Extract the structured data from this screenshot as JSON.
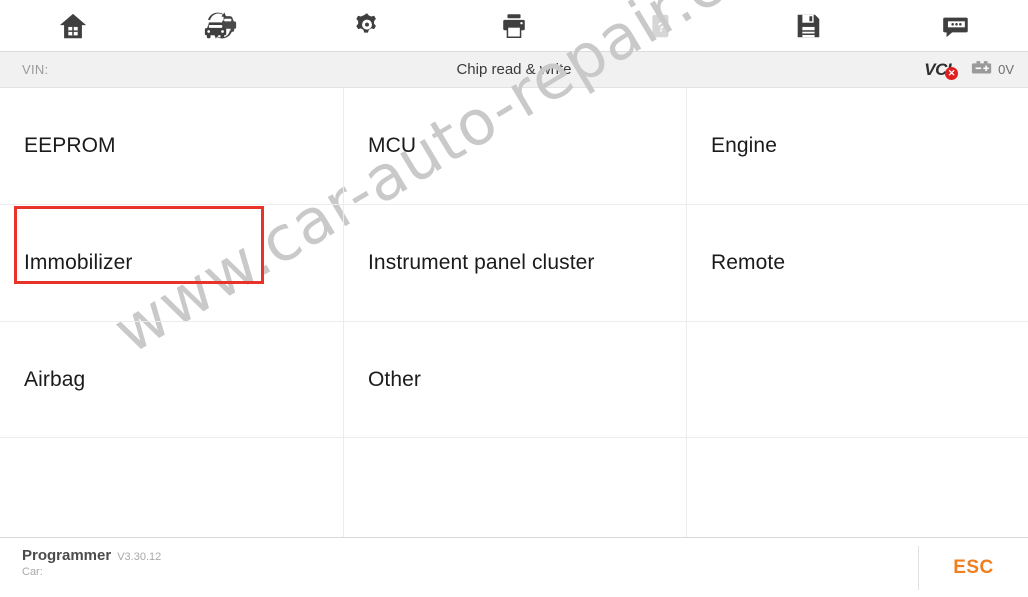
{
  "toolbar": {
    "items": [
      {
        "name": "home-icon",
        "label": "Home",
        "disabled": false
      },
      {
        "name": "vehicle-swap-icon",
        "label": "Vehicle switch",
        "disabled": false
      },
      {
        "name": "gear-icon",
        "label": "Settings",
        "disabled": false
      },
      {
        "name": "printer-icon",
        "label": "Print",
        "disabled": false
      },
      {
        "name": "help-icon",
        "label": "Help",
        "disabled": true
      },
      {
        "name": "save-icon",
        "label": "Save",
        "disabled": false
      },
      {
        "name": "feedback-icon",
        "label": "Feedback",
        "disabled": false
      }
    ]
  },
  "header": {
    "vin_label": "VIN:",
    "vin_value": "",
    "title": "Chip read & write",
    "vci_label": "VCI",
    "vci_badge": "✕",
    "vci_status_color": "#e02020",
    "battery_voltage": "0V"
  },
  "grid": {
    "rows": [
      [
        {
          "label": "EEPROM",
          "selected": false,
          "empty": false
        },
        {
          "label": "MCU",
          "selected": false,
          "empty": false
        },
        {
          "label": "Engine",
          "selected": false,
          "empty": false
        }
      ],
      [
        {
          "label": "Immobilizer",
          "selected": true,
          "empty": false
        },
        {
          "label": "Instrument panel cluster",
          "selected": false,
          "empty": false
        },
        {
          "label": "Remote",
          "selected": false,
          "empty": false
        }
      ],
      [
        {
          "label": "Airbag",
          "selected": false,
          "empty": false
        },
        {
          "label": "Other",
          "selected": false,
          "empty": false
        },
        {
          "label": "",
          "selected": false,
          "empty": true
        }
      ],
      [
        {
          "label": "",
          "selected": false,
          "empty": true
        },
        {
          "label": "",
          "selected": false,
          "empty": true
        },
        {
          "label": "",
          "selected": false,
          "empty": true
        }
      ]
    ],
    "selection_color": "#e8332a"
  },
  "watermark": {
    "text": "www.car-auto-repair.com",
    "color": "#c9c9c9"
  },
  "footer": {
    "app_name": "Programmer",
    "version": "V3.30.12",
    "car_label": "Car:",
    "esc_label": "ESC",
    "esc_color": "#f07f20"
  }
}
